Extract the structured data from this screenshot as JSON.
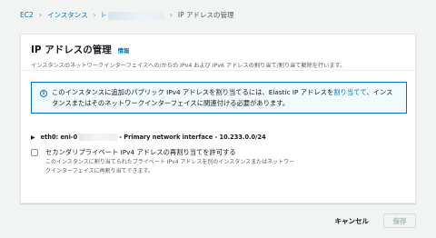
{
  "breadcrumb": {
    "items": [
      "EC2",
      "インスタンス",
      "i-"
    ],
    "current": "IP アドレスの管理"
  },
  "panel": {
    "title": "IP アドレスの管理",
    "info_link": "情報",
    "description": "インスタンスのネットワークインターフェイスへの/からの IPv4 および IPv6 アドレスの割り当て/割り当て解除を行います。"
  },
  "alert": {
    "icon": "info-circle-icon",
    "text_before": "このインスタンスに追加のパブリック IPv4 アドレスを割り当てるには、Elastic IP アドレスを",
    "link": "割り当てて",
    "text_after": "、インスタンスまたはそのネットワークインターフェイスに関連付ける必要があります。"
  },
  "eni": {
    "label": "eth0: eni-0",
    "description": "- Primary network interface - 10.233.0.0/24"
  },
  "reassign": {
    "label": "セカンダリプライベート IPv4 アドレスの再割り当てを許可する",
    "description_line1": "このインスタンスに割り当てられたプライベート IPv4 アドレスを別のインスタンスまたはネットワー",
    "description_line2": "クインターフェイスに再割り当てできます。",
    "checked": false
  },
  "footer": {
    "cancel_label": "キャンセル",
    "save_label": "保存"
  },
  "colors": {
    "link": "#0073bb",
    "alert_bg": "#f1faff",
    "page_bg": "#f2f3f3"
  }
}
